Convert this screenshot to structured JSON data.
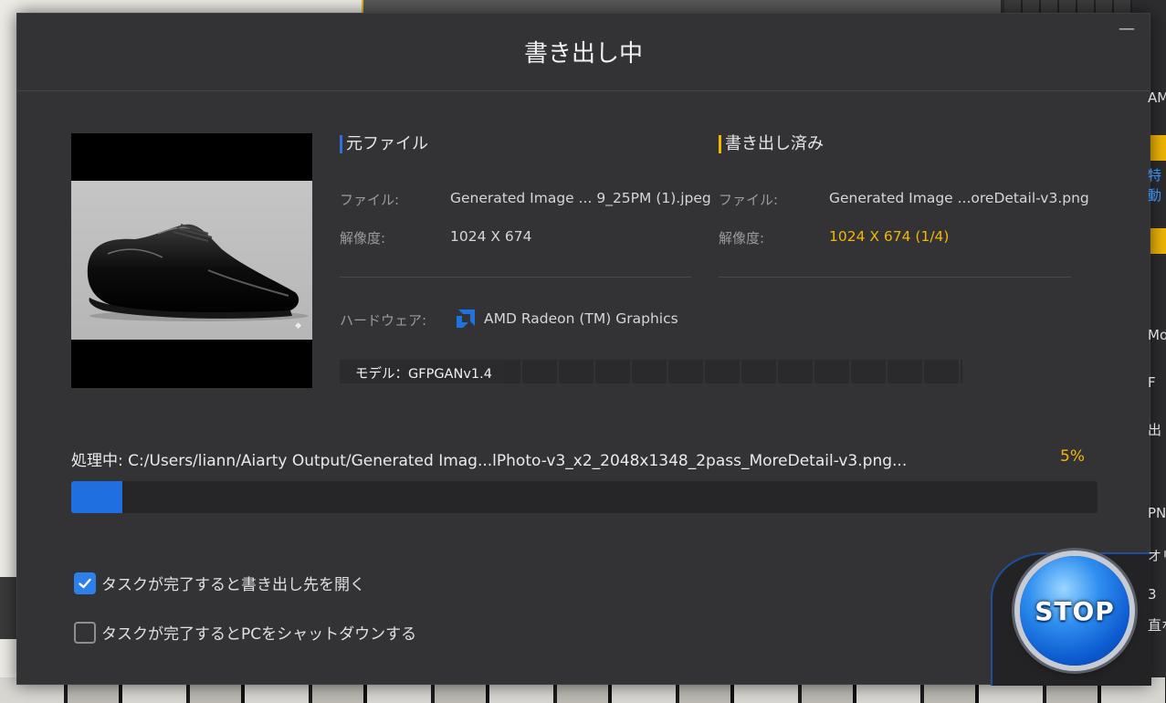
{
  "dialog": {
    "title": "書き出し中",
    "minimize_glyph": "—"
  },
  "source": {
    "heading": "元ファイル",
    "file_label": "ファイル:",
    "file_value": "Generated Image ... 9_25PM (1).jpeg",
    "resolution_label": "解像度:",
    "resolution_value": "1024 X 674"
  },
  "output": {
    "heading": "書き出し済み",
    "file_label": "ファイル:",
    "file_value": "Generated Image ...oreDetail-v3.png",
    "resolution_label": "解像度:",
    "resolution_value": "1024 X 674 (1/4)"
  },
  "hardware": {
    "label": "ハードウェア:",
    "value": "AMD Radeon (TM) Graphics",
    "icon": "amd-logo-icon"
  },
  "model": {
    "text": "モデル：GFPGANv1.4"
  },
  "processing": {
    "label": "処理中:  C:/Users/liann/Aiarty Output/Generated Imag...lPhoto-v3_x2_2048x1348_2pass_MoreDetail-v3.png...",
    "percent_text": "5%",
    "progress": 0.05
  },
  "options": {
    "open_folder_label": "タスクが完了すると書き出し先を開く",
    "open_folder_checked": true,
    "shutdown_label": "タスクが完了するとPCをシャットダウンする",
    "shutdown_checked": false
  },
  "stop_button": {
    "label": "STOP"
  },
  "colors": {
    "accent_blue": "#2d72d9",
    "accent_yellow": "#f2b705",
    "dialog_bg": "#333336"
  }
}
